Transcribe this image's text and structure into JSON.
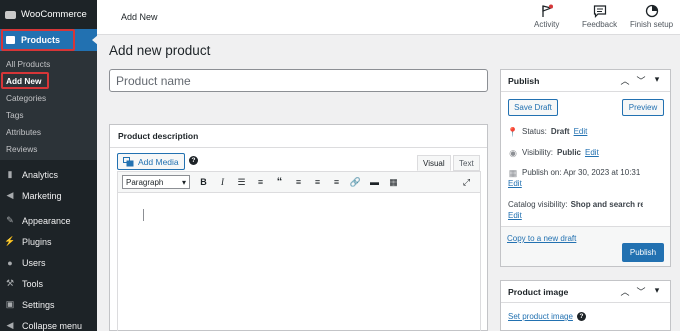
{
  "sidebar": {
    "brand": "WooCommerce",
    "products": "Products",
    "submenu": [
      "All Products",
      "Add New",
      "Categories",
      "Tags",
      "Attributes",
      "Reviews"
    ],
    "items": [
      {
        "label": "Analytics",
        "icon": "bar-chart-icon"
      },
      {
        "label": "Marketing",
        "icon": "megaphone-icon"
      },
      {
        "label": "Appearance",
        "icon": "paintbrush-icon"
      },
      {
        "label": "Plugins",
        "icon": "plug-icon"
      },
      {
        "label": "Users",
        "icon": "user-icon"
      },
      {
        "label": "Tools",
        "icon": "wrench-icon"
      },
      {
        "label": "Settings",
        "icon": "settings-icon"
      },
      {
        "label": "Collapse menu",
        "icon": "collapse-icon"
      }
    ]
  },
  "topbar": {
    "title": "Add New",
    "activity": "Activity",
    "feedback": "Feedback",
    "finish_setup": "Finish setup"
  },
  "main": {
    "page_title": "Add new product",
    "name_placeholder": "Product name",
    "description": {
      "title": "Product description",
      "add_media": "Add Media",
      "tab_visual": "Visual",
      "tab_text": "Text",
      "format": "Paragraph"
    }
  },
  "publish": {
    "title": "Publish",
    "save_draft": "Save Draft",
    "preview": "Preview",
    "status_label": "Status:",
    "status_value": "Draft",
    "visibility_label": "Visibility:",
    "visibility_value": "Public",
    "publish_on": "Publish on: Apr 30, 2023 at 10:31",
    "catalog_label": "Catalog visibility:",
    "catalog_value": "Shop and search results",
    "edit": "Edit",
    "copy_draft": "Copy to a new draft",
    "publish_button": "Publish"
  },
  "product_image": {
    "title": "Product image",
    "set_image": "Set product image"
  },
  "colors": {
    "sidebar_bg": "#1d2327",
    "accent": "#2271b1",
    "highlight_border": "#d63638"
  }
}
